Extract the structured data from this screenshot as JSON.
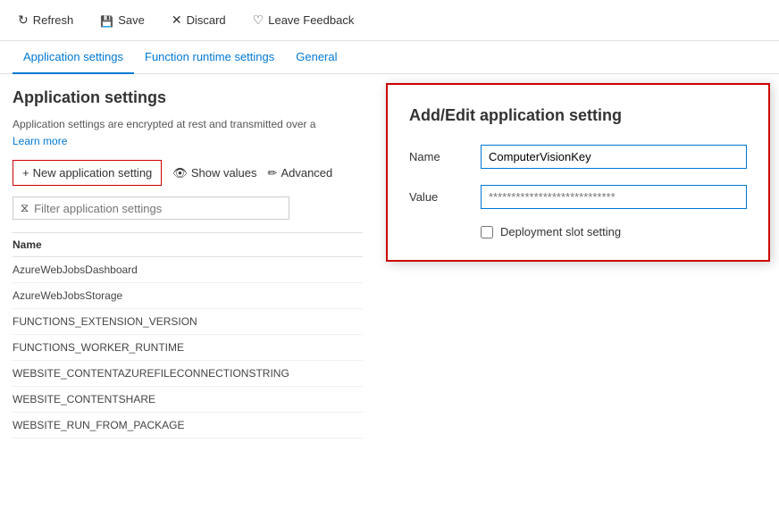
{
  "toolbar": {
    "refresh_label": "Refresh",
    "save_label": "Save",
    "discard_label": "Discard",
    "feedback_label": "Leave Feedback"
  },
  "tabs": {
    "items": [
      {
        "id": "app-settings",
        "label": "Application settings",
        "active": true
      },
      {
        "id": "function-runtime",
        "label": "Function runtime settings",
        "active": false
      },
      {
        "id": "general",
        "label": "General",
        "active": false
      }
    ]
  },
  "page": {
    "title": "Application settings",
    "description": "Application settings are encrypted at rest and transmitted over a",
    "learn_more": "Learn more"
  },
  "actions": {
    "new_setting": "+ New application setting",
    "show_values": "Show values",
    "advanced": "Advanced"
  },
  "filter": {
    "placeholder": "Filter application settings"
  },
  "table": {
    "header": "Name",
    "rows": [
      {
        "name": "AzureWebJobsDashboard"
      },
      {
        "name": "AzureWebJobsStorage"
      },
      {
        "name": "FUNCTIONS_EXTENSION_VERSION"
      },
      {
        "name": "FUNCTIONS_WORKER_RUNTIME"
      },
      {
        "name": "WEBSITE_CONTENTAZUREFILECONNECTIONSTRING"
      },
      {
        "name": "WEBSITE_CONTENTSHARE"
      },
      {
        "name": "WEBSITE_RUN_FROM_PACKAGE"
      }
    ]
  },
  "dialog": {
    "title": "Add/Edit application setting",
    "name_label": "Name",
    "name_value": "ComputerVisionKey",
    "value_label": "Value",
    "value_placeholder": "****************************",
    "deployment_slot_label": "Deployment slot setting",
    "deployment_slot_checked": false
  }
}
